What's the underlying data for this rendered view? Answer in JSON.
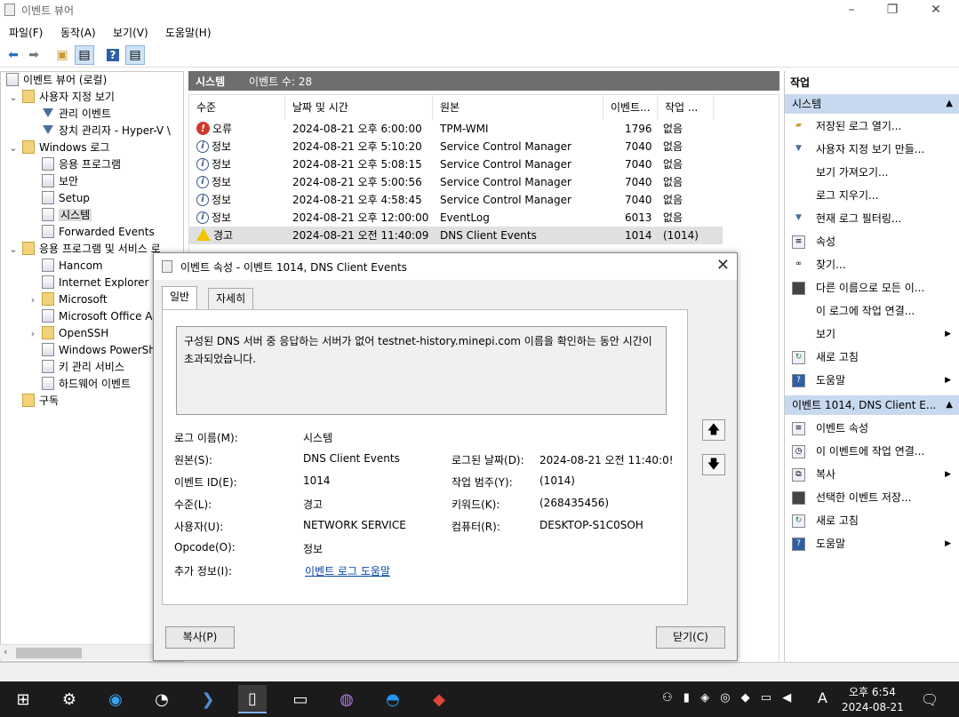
{
  "window": {
    "title": "이벤트 뷰어",
    "controls": [
      "–",
      "❐",
      "✕"
    ]
  },
  "menu": [
    "파일(F)",
    "동작(A)",
    "보기(V)",
    "도움말(H)"
  ],
  "tree": {
    "items": [
      {
        "label": "이벤트 뷰어 (로컬)"
      },
      {
        "label": "사용자 지정 보기"
      },
      {
        "label": "관리 이벤트"
      },
      {
        "label": "장치 관리자 - Hyper-V \\"
      },
      {
        "label": "Windows 로그"
      },
      {
        "label": "응용 프로그램"
      },
      {
        "label": "보안"
      },
      {
        "label": "Setup"
      },
      {
        "label": "시스템"
      },
      {
        "label": "Forwarded Events"
      },
      {
        "label": "응용 프로그램 및 서비스 로"
      },
      {
        "label": "Hancom"
      },
      {
        "label": "Internet Explorer"
      },
      {
        "label": "Microsoft"
      },
      {
        "label": "Microsoft Office A"
      },
      {
        "label": "OpenSSH"
      },
      {
        "label": "Windows PowerSh"
      },
      {
        "label": "키 관리 서비스"
      },
      {
        "label": "하드웨어 이벤트"
      },
      {
        "label": "구독"
      }
    ]
  },
  "center": {
    "log_name": "시스템",
    "event_count": "이벤트 수: 28",
    "columns": [
      "수준",
      "날짜 및 시간",
      "원본",
      "이벤트...",
      "작업 ..."
    ],
    "rows": [
      {
        "level": "오류",
        "type": "error",
        "datetime": "2024-08-21 오후 6:00:00",
        "source": "TPM-WMI",
        "id": "1796",
        "task": "없음"
      },
      {
        "level": "정보",
        "type": "info",
        "datetime": "2024-08-21 오후 5:10:20",
        "source": "Service Control Manager",
        "id": "7040",
        "task": "없음"
      },
      {
        "level": "정보",
        "type": "info",
        "datetime": "2024-08-21 오후 5:08:15",
        "source": "Service Control Manager",
        "id": "7040",
        "task": "없음"
      },
      {
        "level": "정보",
        "type": "info",
        "datetime": "2024-08-21 오후 5:00:56",
        "source": "Service Control Manager",
        "id": "7040",
        "task": "없음"
      },
      {
        "level": "정보",
        "type": "info",
        "datetime": "2024-08-21 오후 4:58:45",
        "source": "Service Control Manager",
        "id": "7040",
        "task": "없음"
      },
      {
        "level": "정보",
        "type": "info",
        "datetime": "2024-08-21 오후 12:00:00",
        "source": "EventLog",
        "id": "6013",
        "task": "없음"
      },
      {
        "level": "경고",
        "type": "warning",
        "datetime": "2024-08-21 오전 11:40:09",
        "source": "DNS Client Events",
        "id": "1014",
        "task": "(1014)"
      }
    ]
  },
  "actions": {
    "title": "작업",
    "section1": "시스템",
    "section1_items": [
      "저장된 로그 열기...",
      "사용자 지정 보기 만들...",
      "보기 가져오기...",
      "로그 지우기...",
      "현재 로그 필터링...",
      "속성",
      "찾기...",
      "다른 이름으로 모든 이...",
      "이 로그에 작업 연결...",
      "보기",
      "새로 고침",
      "도움말"
    ],
    "section2": "이벤트 1014, DNS Client E...",
    "section2_items": [
      "이벤트 속성",
      "이 이벤트에 작업 연결...",
      "복사",
      "선택한 이벤트 저장...",
      "새로 고침",
      "도움말"
    ]
  },
  "dialog": {
    "title": "이벤트 속성 - 이벤트 1014, DNS Client Events",
    "tabs": [
      "일반",
      "자세히"
    ],
    "description": "구성된 DNS 서버 중 응답하는 서버가 없어 testnet-history.minepi.com 이름을 확인하는 동안 시간이 초과되었습니다.",
    "fields": {
      "log_name_label": "로그 이름(M):",
      "log_name": "시스템",
      "source_label": "원본(S):",
      "source": "DNS Client Events",
      "logged_label": "로그된 날짜(D):",
      "logged": "2024-08-21 오전 11:40:0!",
      "event_id_label": "이벤트 ID(E):",
      "event_id": "1014",
      "task_label": "작업 범주(Y):",
      "task": "(1014)",
      "level_label": "수준(L):",
      "level": "경고",
      "keywords_label": "키워드(K):",
      "keywords": "(268435456)",
      "user_label": "사용자(U):",
      "user": "NETWORK SERVICE",
      "computer_label": "컴퓨터(R):",
      "computer": "DESKTOP-S1C0SOH",
      "opcode_label": "Opcode(O):",
      "opcode": "정보",
      "more_label": "추가 정보(I):",
      "more_link": "이벤트 로그 도움말"
    },
    "copy_button": "복사(P)",
    "close_button": "닫기(C)"
  },
  "taskbar": {
    "time": "오후 6:54",
    "date": "2024-08-21",
    "ime": "A"
  }
}
